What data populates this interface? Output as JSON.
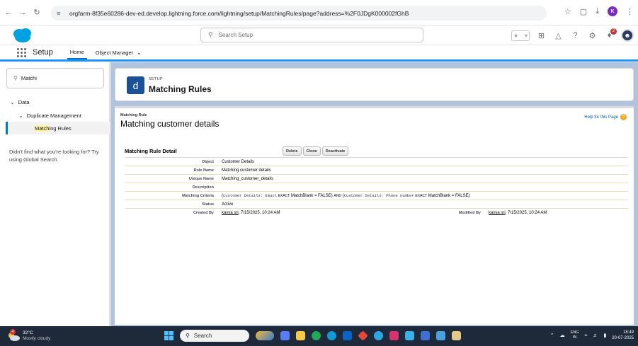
{
  "browser": {
    "url": "orgfarm-8f35e60286-dev-ed.develop.lightning.force.com/lightning/setup/MatchingRules/page?address=%2F0JDgK000002fGhB",
    "profile_initial": "K"
  },
  "header": {
    "search_placeholder": "Search Setup",
    "notification_count": "2"
  },
  "nav": {
    "app_name": "Setup",
    "tabs": [
      {
        "label": "Home"
      },
      {
        "label": "Object Manager"
      }
    ]
  },
  "sidebar": {
    "quickfind_value": "Matchi",
    "tree": {
      "data_label": "Data",
      "dup_label": "Duplicate Management",
      "match_prefix": "Match",
      "match_rest": "ing Rules"
    },
    "no_find_text": "Didn't find what you're looking for? Try using Global Search."
  },
  "page_header": {
    "icon_letter": "d",
    "subtitle": "SETUP",
    "title": "Matching Rules"
  },
  "detail": {
    "entity_label": "Matching Rule",
    "entity_name": "Matching customer details",
    "help_link": "Help for this Page",
    "section_title": "Matching Rule Detail",
    "buttons": [
      "Delete",
      "Clone",
      "Deactivate"
    ],
    "fields": {
      "object": {
        "label": "Object",
        "value": "Customer Details"
      },
      "rule_name": {
        "label": "Rule Name",
        "value": "Matching customer details"
      },
      "unique_name": {
        "label": "Unique Name",
        "value": "Matching_customer_details"
      },
      "description": {
        "label": "Description",
        "value": ""
      },
      "criteria": {
        "label": "Matching Criteria",
        "part1_open": "(",
        "part1_field": "Customer Details: Email",
        "part1_exact": "EXACT",
        "part1_blank": "MatchBlank = FALSE)",
        "and_word": "AND",
        "part2_open": "(",
        "part2_field": "Customer Details: Phone number",
        "part2_exact": "EXACT",
        "part2_blank": "MatchBlank = FALSE)"
      },
      "status": {
        "label": "Status",
        "value": "Active"
      },
      "created_by": {
        "label": "Created By",
        "user": "kavya sri",
        "date": ", 7/15/2025, 10:24 AM"
      },
      "modified_by": {
        "label": "Modified By",
        "user": "kavya sri",
        "date": ", 7/15/2025, 10:24 AM"
      }
    }
  },
  "taskbar": {
    "temp": "32°C",
    "weather": "Mostly cloudy",
    "weather_badge": "4",
    "search": "Search",
    "lang_top": "ENG",
    "lang_bottom": "IN",
    "time": "18:49",
    "date": "20-07-2025"
  }
}
